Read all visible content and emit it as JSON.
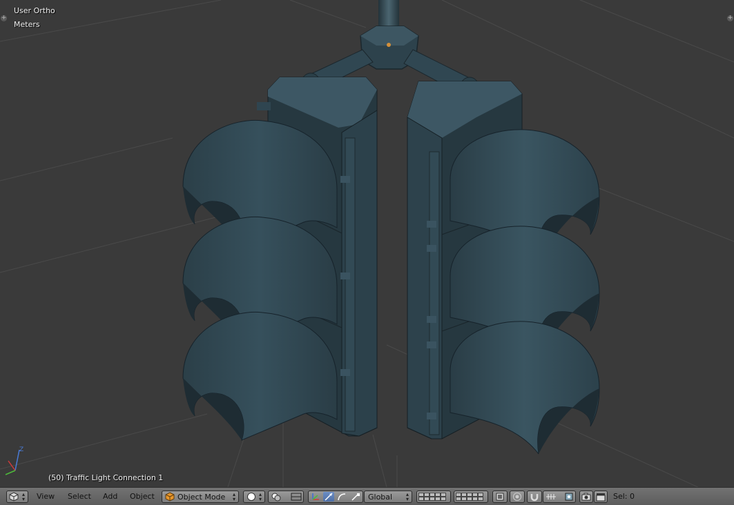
{
  "viewport": {
    "view_label": "User Ortho",
    "units_label": "Meters",
    "object_label": "(50) Traffic Light Connection 1",
    "axis": {
      "z": "Z"
    }
  },
  "header": {
    "editor_icon": "cube-icon",
    "menus": {
      "view": "View",
      "select": "Select",
      "add": "Add",
      "object": "Object"
    },
    "mode": "Object Mode",
    "pivot_icon": "pivot-icon",
    "orientation": "Global",
    "selection_count": "Sel: 0"
  },
  "colors": {
    "viewport_bg": "#3a3a3a",
    "model": "#2f4650",
    "header": "#6a6a6a",
    "active_button": "#5a7fb8"
  }
}
